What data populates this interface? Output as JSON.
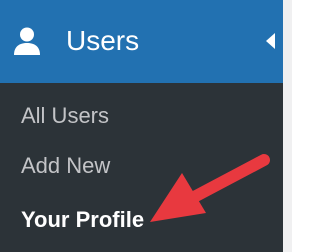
{
  "menu": {
    "title": "Users",
    "icon": "user-icon",
    "items": [
      {
        "label": "All Users",
        "current": false
      },
      {
        "label": "Add New",
        "current": false
      },
      {
        "label": "Your Profile",
        "current": true
      }
    ]
  },
  "annotation": {
    "type": "red-arrow",
    "points_to": "Your Profile"
  },
  "colors": {
    "header_bg": "#2271b1",
    "sidebar_bg": "#2c3338",
    "item_text": "#c3c4c7",
    "current_text": "#ffffff",
    "arrow": "#e8393f"
  }
}
